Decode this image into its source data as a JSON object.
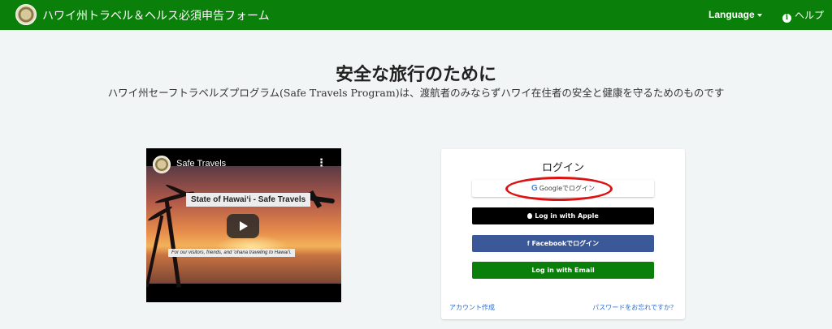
{
  "header": {
    "brand_title": "ハワイ州トラベル＆ヘルス必須申告フォーム",
    "language_label": "Language",
    "help_label": "ヘルプ",
    "brand_color": "#0a7f0a"
  },
  "hero": {
    "title": "安全な旅行のために",
    "subtitle": "ハワイ州セーフトラベルズプログラム(Safe Travels Program)は、渡航者のみならずハワイ在住者の安全と健康を守るためのものです"
  },
  "video": {
    "channel_title": "Safe Travels",
    "banner_text": "State of Hawaiʻi - Safe Travels",
    "caption_text": "For our visitors, friends, and ʻohana traveling to Hawaiʻi."
  },
  "login": {
    "title": "ログイン",
    "google_label": "Googleでログイン",
    "apple_label": "Log in with Apple",
    "facebook_label": "Facebookでログイン",
    "email_label": "Log in with Email",
    "create_account_label": "アカウント作成",
    "forgot_password_label": "パスワードをお忘れですか？",
    "facebook_color": "#3b5998",
    "email_color": "#0a7f0a"
  },
  "icons": {
    "seal": "hawaii-state-seal-icon",
    "info": "info-icon",
    "caret": "caret-down-icon",
    "google": "google-icon",
    "apple": "apple-icon",
    "facebook": "facebook-icon",
    "play": "play-icon",
    "kebab": "kebab-menu-icon"
  }
}
